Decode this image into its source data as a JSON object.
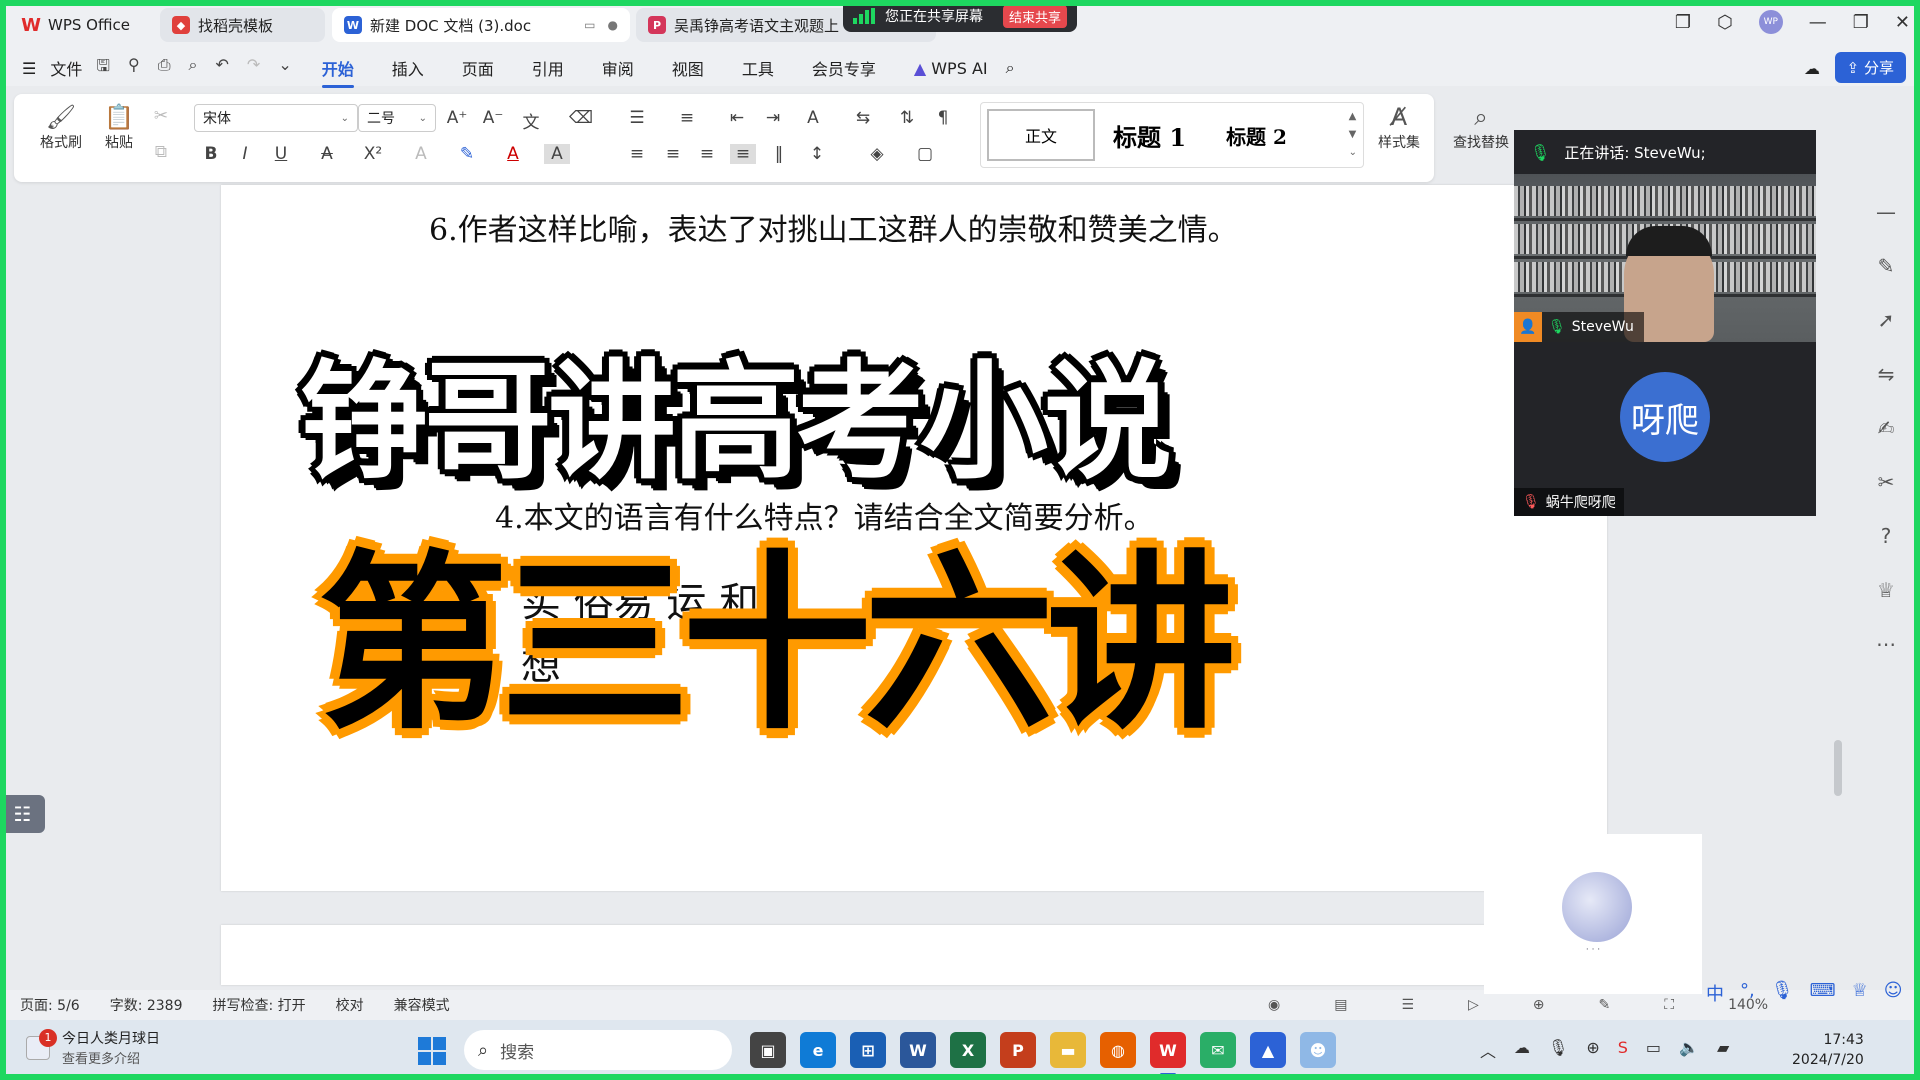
{
  "tabs": [
    {
      "label": "WPS Office"
    },
    {
      "label": "找稻壳模板"
    },
    {
      "label": "新建 DOC 文档 (3).doc"
    },
    {
      "label": "吴禹铮高考语文主观题上"
    }
  ],
  "share_banner": {
    "text": "您正在共享屏幕",
    "stop_label": "结束共享"
  },
  "user_avatar": "WP",
  "menu": {
    "file": "文件",
    "items": [
      "开始",
      "插入",
      "页面",
      "引用",
      "审阅",
      "视图",
      "工具",
      "会员专享"
    ],
    "active": "开始",
    "wps_ai": "WPS AI",
    "share": "分享"
  },
  "ribbon": {
    "format_painter": "格式刷",
    "paste": "粘贴",
    "font_name": "宋体",
    "font_size": "二号",
    "style_normal": "正文",
    "style_h1": "标题 1",
    "style_h2": "标题 2",
    "style_set": "样式集",
    "find_replace": "查找替换"
  },
  "document": {
    "line6": "6.作者这样比喻，表达了对挑山工这群人的崇敬和赞美之情。",
    "line4": "4.本文的语言有什么特点？请结合全文简要分析。",
    "partial1": "实     俗易     运     和",
    "partial2": "想"
  },
  "overlay": {
    "title1": "铮哥讲高考小说",
    "title2": "第三十六讲"
  },
  "meeting": {
    "speaking": "正在讲话:  SteveWu;",
    "participant1": "SteveWu",
    "participant2_avatar": "呀爬",
    "participant2": "蜗牛爬呀爬"
  },
  "status": {
    "page": "页面: 5/6",
    "words": "字数: 2389",
    "spellcheck": "拼写检查: 打开",
    "proofread": "校对",
    "compat": "兼容模式",
    "zoom": "140%"
  },
  "taskbar": {
    "weather_title": "今日人类月球日",
    "weather_sub": "查看更多介绍",
    "badge": "1",
    "search": "搜索",
    "time": "17:43",
    "date": "2024/7/20"
  },
  "colors": {
    "accent": "#2c62d6",
    "share_border": "#1ed760",
    "title2_outline": "#ff9a00"
  }
}
